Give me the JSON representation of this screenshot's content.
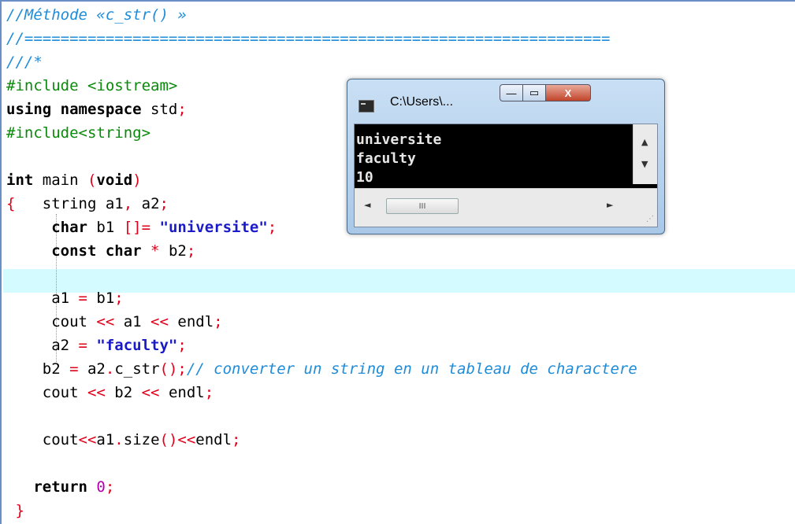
{
  "editor": {
    "lines": [
      [
        {
          "t": "//Méthode «c_str() »",
          "c": "cmt"
        }
      ],
      [
        {
          "t": "//=================================================================",
          "c": "cmt"
        }
      ],
      [
        {
          "t": "///*",
          "c": "cmt"
        }
      ],
      [
        {
          "t": "#include <iostream>",
          "c": "pp"
        }
      ],
      [
        {
          "t": "using namespace",
          "c": "kw"
        },
        {
          "t": " std"
        },
        {
          "t": ";",
          "c": "op"
        }
      ],
      [
        {
          "t": "#include<string>",
          "c": "pp"
        }
      ],
      [
        {
          "t": ""
        }
      ],
      [
        {
          "t": "int",
          "c": "kw"
        },
        {
          "t": " main "
        },
        {
          "t": "(",
          "c": "op"
        },
        {
          "t": "void",
          "c": "kw"
        },
        {
          "t": ")",
          "c": "op"
        }
      ],
      [
        {
          "t": "{",
          "c": "op"
        },
        {
          "t": "   string a1"
        },
        {
          "t": ",",
          "c": "op"
        },
        {
          "t": " a2"
        },
        {
          "t": ";",
          "c": "op"
        }
      ],
      [
        {
          "t": "     "
        },
        {
          "t": "char",
          "c": "kw"
        },
        {
          "t": " b1 "
        },
        {
          "t": "[]=",
          "c": "op"
        },
        {
          "t": " "
        },
        {
          "t": "\"universite\"",
          "c": "str"
        },
        {
          "t": ";",
          "c": "op"
        }
      ],
      [
        {
          "t": "     "
        },
        {
          "t": "const char",
          "c": "kw"
        },
        {
          "t": " "
        },
        {
          "t": "*",
          "c": "op"
        },
        {
          "t": " b2"
        },
        {
          "t": ";",
          "c": "op"
        }
      ],
      [
        {
          "t": ""
        }
      ],
      [
        {
          "t": "     a1 "
        },
        {
          "t": "=",
          "c": "op"
        },
        {
          "t": " b1"
        },
        {
          "t": ";",
          "c": "op"
        }
      ],
      [
        {
          "t": "     cout "
        },
        {
          "t": "<<",
          "c": "op"
        },
        {
          "t": " a1 "
        },
        {
          "t": "<<",
          "c": "op"
        },
        {
          "t": " endl"
        },
        {
          "t": ";",
          "c": "op"
        }
      ],
      [
        {
          "t": "     a2 "
        },
        {
          "t": "=",
          "c": "op"
        },
        {
          "t": " "
        },
        {
          "t": "\"faculty\"",
          "c": "str"
        },
        {
          "t": ";",
          "c": "op"
        }
      ],
      [
        {
          "t": "    b2 "
        },
        {
          "t": "=",
          "c": "op"
        },
        {
          "t": " a2"
        },
        {
          "t": ".",
          "c": "op"
        },
        {
          "t": "c_str"
        },
        {
          "t": "();",
          "c": "op"
        },
        {
          "t": "// converter un string en un tableau de charactere",
          "c": "cmt"
        }
      ],
      [
        {
          "t": "    cout "
        },
        {
          "t": "<<",
          "c": "op"
        },
        {
          "t": " b2 "
        },
        {
          "t": "<<",
          "c": "op"
        },
        {
          "t": " endl"
        },
        {
          "t": ";",
          "c": "op"
        }
      ],
      [
        {
          "t": ""
        }
      ],
      [
        {
          "t": "    cout"
        },
        {
          "t": "<<",
          "c": "op"
        },
        {
          "t": "a1"
        },
        {
          "t": ".",
          "c": "op"
        },
        {
          "t": "size"
        },
        {
          "t": "()<<",
          "c": "op"
        },
        {
          "t": "endl"
        },
        {
          "t": ";",
          "c": "op"
        }
      ],
      [
        {
          "t": ""
        }
      ],
      [
        {
          "t": "   "
        },
        {
          "t": "return",
          "c": "kw"
        },
        {
          "t": " "
        },
        {
          "t": "0",
          "c": "num"
        },
        {
          "t": ";",
          "c": "op"
        }
      ],
      [
        {
          "t": " "
        },
        {
          "t": "}",
          "c": "op"
        }
      ]
    ]
  },
  "console": {
    "title": "C:\\Users\\...",
    "output_lines": [
      "universite",
      "faculty",
      "10"
    ],
    "btn_min": "—",
    "btn_max": "▭",
    "btn_close": "X",
    "scroll_up": "▲",
    "scroll_down": "▼",
    "scroll_left": "◄",
    "scroll_right": "►",
    "thumb_grip": "III",
    "resize_grip": "⋰"
  },
  "colors": {
    "comment": "#1e8cd9",
    "preprocessor": "#0a8a0a",
    "string": "#1a1ac8",
    "operator": "#e0001a",
    "number": "#b000b0",
    "current_line": "#d4fbff"
  }
}
